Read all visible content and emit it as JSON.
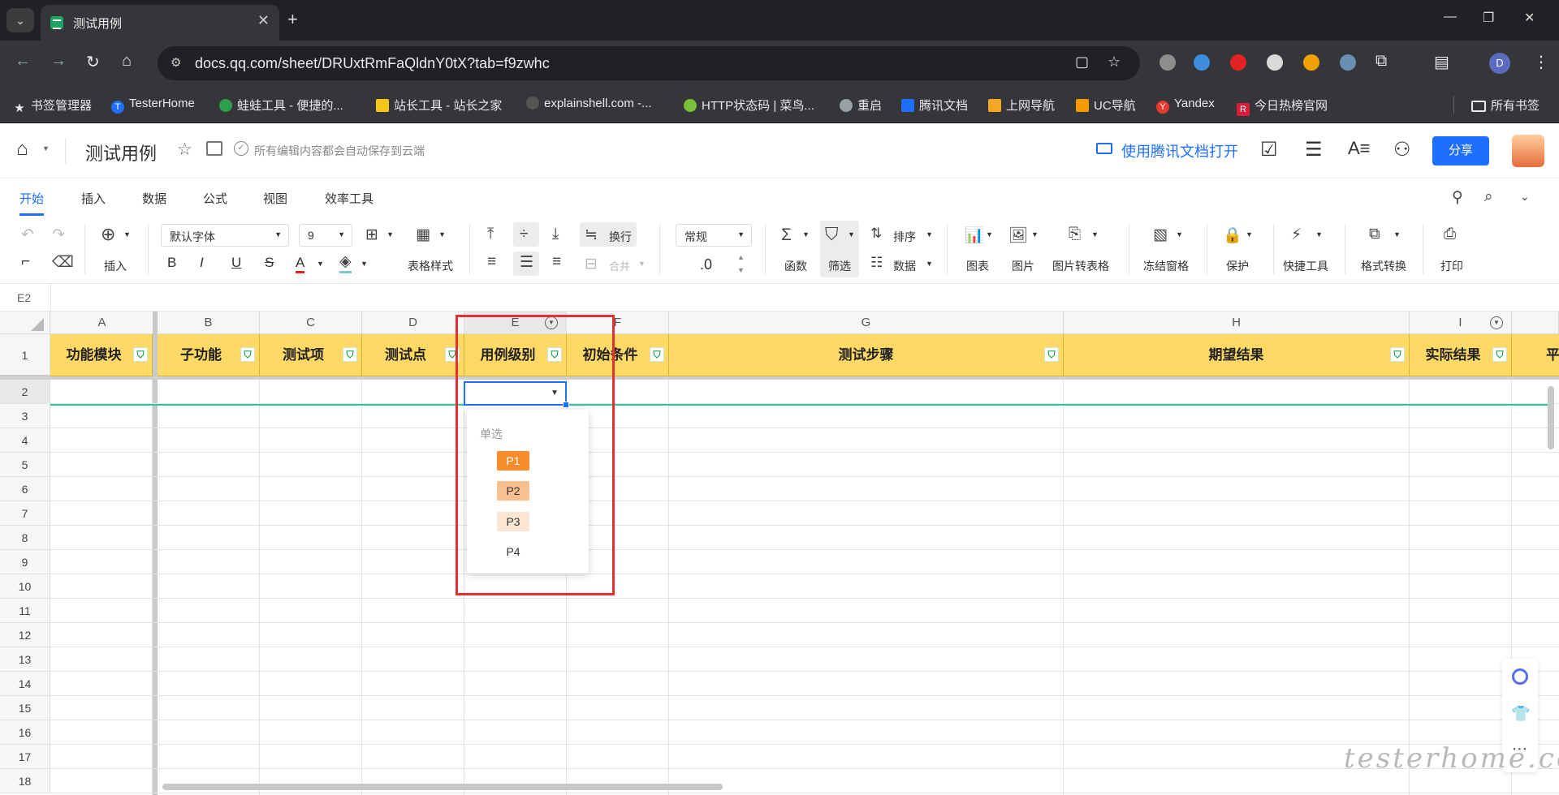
{
  "browser": {
    "tab_title": "测试用例",
    "url": "docs.qq.com/sheet/DRUxtRmFaQldnY0tX?tab=f9zwhc",
    "profile_initial": "D",
    "bookmarks": [
      {
        "label": "书签管理器",
        "color": "#e8eaed"
      },
      {
        "label": "TesterHome",
        "color": "#1e6fff"
      },
      {
        "label": "蛙蛙工具 - 便捷的...",
        "color": "#2e9e4f"
      },
      {
        "label": "站长工具 - 站长之家",
        "color": "#f5c518"
      },
      {
        "label": "explainshell.com -...",
        "color": "#555555"
      },
      {
        "label": "HTTP状态码 | 菜鸟...",
        "color": "#7cbf3a"
      },
      {
        "label": "重启",
        "color": "#9aa0a6"
      },
      {
        "label": "腾讯文档",
        "color": "#1e6fff"
      },
      {
        "label": "上网导航",
        "color": "#f5a623"
      },
      {
        "label": "UC导航",
        "color": "#f59b00"
      },
      {
        "label": "Yandex",
        "color": "#e63b2e"
      },
      {
        "label": "今日热榜官网",
        "color": "#d81e3a"
      }
    ],
    "all_bookmarks": "所有书签"
  },
  "app": {
    "doc_title": "测试用例",
    "save_hint": "所有编辑内容都会自动保存到云端",
    "open_in_app": "使用腾讯文档打开",
    "share": "分享"
  },
  "menu_tabs": [
    "开始",
    "插入",
    "数据",
    "公式",
    "视图",
    "效率工具"
  ],
  "toolbar": {
    "insert": "插入",
    "font": "默认字体",
    "font_size": "9",
    "table_style": "表格样式",
    "wrap": "换行",
    "merge": "合并",
    "number_format": "常规",
    "decimal": ".0",
    "function": "函数",
    "filter": "筛选",
    "sort": "排序",
    "data": "数据",
    "chart": "图表",
    "image": "图片",
    "image_to_table": "图片转表格",
    "freeze": "冻结窗格",
    "protect": "保护",
    "quick_tools": "快捷工具",
    "format_convert": "格式转换",
    "print": "打印",
    "format_labels": [
      "B",
      "I",
      "U",
      "S",
      "A"
    ]
  },
  "formula_bar": {
    "cell_ref": "E2"
  },
  "sheet": {
    "columns": [
      "A",
      "B",
      "C",
      "D",
      "E",
      "F",
      "G",
      "H",
      "I"
    ],
    "headers": [
      "功能模块",
      "子功能",
      "测试项",
      "测试点",
      "用例级别",
      "初始条件",
      "测试步骤",
      "期望结果",
      "实际结果",
      "平"
    ],
    "rows": [
      "1",
      "2",
      "3",
      "4",
      "5",
      "6",
      "7",
      "8",
      "9",
      "10",
      "11",
      "12",
      "13",
      "14",
      "15",
      "16",
      "17",
      "18"
    ],
    "header_color": "#ffd966"
  },
  "dropdown": {
    "title": "单选",
    "options": [
      {
        "label": "P1",
        "bg": "#f58b2a",
        "fg": "#ffffff"
      },
      {
        "label": "P2",
        "bg": "#f9c08f",
        "fg": "#333333"
      },
      {
        "label": "P3",
        "bg": "#fde6d3",
        "fg": "#333333"
      },
      {
        "label": "P4",
        "bg": "#ffffff",
        "fg": "#333333"
      }
    ]
  },
  "watermark": "testerhome.com"
}
